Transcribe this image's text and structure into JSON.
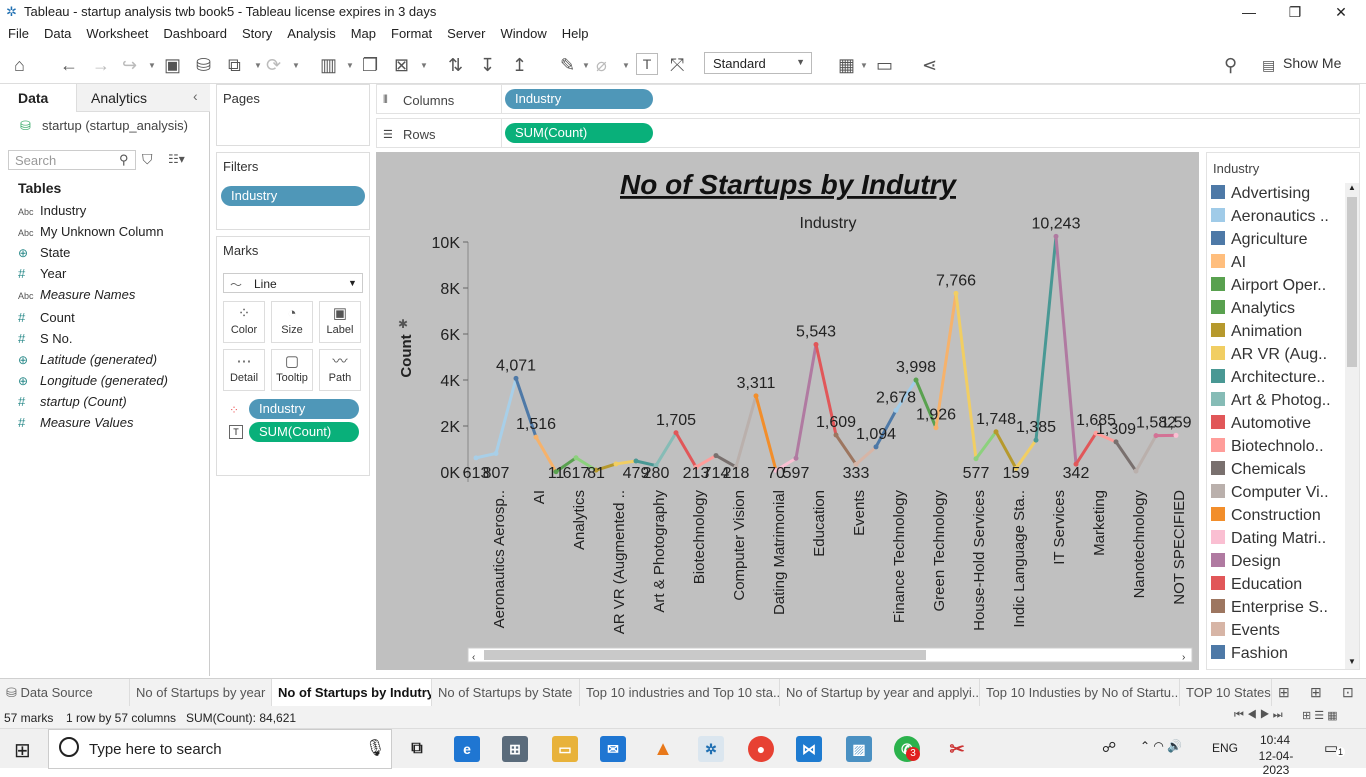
{
  "app": {
    "title": "Tableau - startup analysis twb book5 - Tableau license expires in 3 days",
    "window_controls": {
      "minimize": "—",
      "restore": "❐",
      "close": "✕"
    }
  },
  "menu": [
    "File",
    "Data",
    "Worksheet",
    "Dashboard",
    "Story",
    "Analysis",
    "Map",
    "Format",
    "Server",
    "Window",
    "Help"
  ],
  "toolbar": {
    "fit_select": "Standard",
    "show_me": "Show Me"
  },
  "left_pane": {
    "tabs": {
      "data": "Data",
      "analytics": "Analytics"
    },
    "datasource": "startup (startup_analysis)",
    "search_placeholder": "Search",
    "tables_header": "Tables",
    "fields": [
      {
        "type": "Abc",
        "name": "Industry",
        "italic": false,
        "kind": "dim"
      },
      {
        "type": "Abc",
        "name": "My Unknown Column",
        "italic": false,
        "kind": "dim"
      },
      {
        "type": "geo",
        "name": "State",
        "italic": false,
        "kind": "geo"
      },
      {
        "type": "#",
        "name": "Year",
        "italic": false,
        "kind": "num"
      },
      {
        "type": "Abc",
        "name": "Measure Names",
        "italic": true,
        "kind": "dim"
      },
      {
        "type": "#",
        "name": "Count",
        "italic": false,
        "kind": "num"
      },
      {
        "type": "#",
        "name": "S No.",
        "italic": false,
        "kind": "num"
      },
      {
        "type": "geo",
        "name": "Latitude (generated)",
        "italic": true,
        "kind": "geo"
      },
      {
        "type": "geo",
        "name": "Longitude (generated)",
        "italic": true,
        "kind": "geo"
      },
      {
        "type": "#",
        "name": "startup (Count)",
        "italic": true,
        "kind": "num"
      },
      {
        "type": "#",
        "name": "Measure Values",
        "italic": true,
        "kind": "num"
      }
    ]
  },
  "cards": {
    "pages": "Pages",
    "filters": "Filters",
    "filter_pill": "Industry",
    "marks": "Marks",
    "mark_type": "Line",
    "mark_buttons": [
      "Color",
      "Size",
      "Label",
      "Detail",
      "Tooltip",
      "Path"
    ],
    "mark_pills": [
      "Industry",
      "SUM(Count)"
    ]
  },
  "shelves": {
    "columns_label": "Columns",
    "columns_pill": "Industry",
    "rows_label": "Rows",
    "rows_pill": "SUM(Count)"
  },
  "chart_data": {
    "type": "line",
    "title": "No of Startups by Indutry",
    "header": "Industry",
    "ylabel": "Count",
    "ylim": [
      0,
      11000
    ],
    "yticks": [
      "0K",
      "2K",
      "4K",
      "6K",
      "8K",
      "10K"
    ],
    "x_labels": [
      "Aeronautics Aerosp..",
      "AI",
      "Analytics",
      "AR VR (Augmented ..",
      "Art & Photography",
      "Biotechnology",
      "Computer Vision",
      "Dating Matrimonial",
      "Education",
      "Events",
      "Finance Technology",
      "Green Technology",
      "House-Hold Services",
      "Indic Language Sta..",
      "IT Services",
      "Marketing",
      "Nanotechnology",
      "NOT SPECIFIED"
    ],
    "points": [
      {
        "label": "613",
        "value": 613,
        "color": "#a8cfe8"
      },
      {
        "label": "807",
        "value": 807,
        "color": "#a8cfe8"
      },
      {
        "label": "4,071",
        "value": 4071,
        "color": "#4e79a7"
      },
      {
        "label": "1,516",
        "value": 1516,
        "color": "#f6b26b"
      },
      {
        "label": "11",
        "value": 11,
        "color": "#59a14f"
      },
      {
        "label": "617",
        "value": 617,
        "color": "#8cd17d"
      },
      {
        "label": "81",
        "value": 81,
        "color": "#b6992d"
      },
      {
        "label": "",
        "value": 350,
        "color": "#f1ce63"
      },
      {
        "label": "479",
        "value": 479,
        "color": "#499894"
      },
      {
        "label": "280",
        "value": 280,
        "color": "#86bcb6"
      },
      {
        "label": "1,705",
        "value": 1705,
        "color": "#e15759"
      },
      {
        "label": "213",
        "value": 213,
        "color": "#ff9d9a"
      },
      {
        "label": "714",
        "value": 714,
        "color": "#79706e"
      },
      {
        "label": "218",
        "value": 218,
        "color": "#bab0ac"
      },
      {
        "label": "3,311",
        "value": 3311,
        "color": "#f28e2b"
      },
      {
        "label": "70",
        "value": 70,
        "color": "#fabfd2"
      },
      {
        "label": "597",
        "value": 597,
        "color": "#b07aa1"
      },
      {
        "label": "5,543",
        "value": 5543,
        "color": "#e15759"
      },
      {
        "label": "1,609",
        "value": 1609,
        "color": "#9d7660"
      },
      {
        "label": "333",
        "value": 333,
        "color": "#d7b5a6"
      },
      {
        "label": "1,094",
        "value": 1094,
        "color": "#4e79a7"
      },
      {
        "label": "2,678",
        "value": 2678,
        "color": "#a0cbe8"
      },
      {
        "label": "3,998",
        "value": 3998,
        "color": "#59a14f"
      },
      {
        "label": "1,926",
        "value": 1926,
        "color": "#f6b26b"
      },
      {
        "label": "7,766",
        "value": 7766,
        "color": "#f1ce63"
      },
      {
        "label": "577",
        "value": 577,
        "color": "#8cd17d"
      },
      {
        "label": "1,748",
        "value": 1748,
        "color": "#b6992d"
      },
      {
        "label": "159",
        "value": 159,
        "color": "#f1ce63"
      },
      {
        "label": "1,385",
        "value": 1385,
        "color": "#499894"
      },
      {
        "label": "10,243",
        "value": 10243,
        "color": "#b07aa1"
      },
      {
        "label": "342",
        "value": 342,
        "color": "#e15759"
      },
      {
        "label": "1,685",
        "value": 1685,
        "color": "#ff9d9a"
      },
      {
        "label": "1,309",
        "value": 1309,
        "color": "#79706e"
      },
      {
        "label": "",
        "value": 40,
        "color": "#bab0ac"
      },
      {
        "label": "1,582",
        "value": 1582,
        "color": "#d37295"
      },
      {
        "label": "1,59",
        "value": 1590,
        "color": "#fabfd2"
      }
    ]
  },
  "legend": {
    "title": "Industry",
    "items": [
      {
        "name": "Advertising",
        "color": "#4e79a7"
      },
      {
        "name": "Aeronautics ..",
        "color": "#a0cbe8"
      },
      {
        "name": "Agriculture",
        "color": "#4e79a7"
      },
      {
        "name": "AI",
        "color": "#ffbe7d"
      },
      {
        "name": "Airport Oper..",
        "color": "#59a14f"
      },
      {
        "name": "Analytics",
        "color": "#59a14f"
      },
      {
        "name": "Animation",
        "color": "#b6992d"
      },
      {
        "name": "AR VR (Aug..",
        "color": "#f1ce63"
      },
      {
        "name": "Architecture..",
        "color": "#499894"
      },
      {
        "name": "Art & Photog..",
        "color": "#86bcb6"
      },
      {
        "name": "Automotive",
        "color": "#e15759"
      },
      {
        "name": "Biotechnolo..",
        "color": "#ff9d9a"
      },
      {
        "name": "Chemicals",
        "color": "#79706e"
      },
      {
        "name": "Computer Vi..",
        "color": "#bab0ac"
      },
      {
        "name": "Construction",
        "color": "#f28e2b"
      },
      {
        "name": "Dating Matri..",
        "color": "#fabfd2"
      },
      {
        "name": "Design",
        "color": "#b07aa1"
      },
      {
        "name": "Education",
        "color": "#e15759"
      },
      {
        "name": "Enterprise S..",
        "color": "#9d7660"
      },
      {
        "name": "Events",
        "color": "#d7b5a6"
      },
      {
        "name": "Fashion",
        "color": "#4e79a7"
      }
    ]
  },
  "sheet_tabs": {
    "data_source": "Data Source",
    "tabs": [
      "No of Startups by year",
      "No of Startups by Indutry",
      "No of Startups by State",
      "Top 10 industries and Top 10 sta...",
      "No of Startup by year and applyi...",
      "Top 10 Industies by No of Startu...",
      "TOP 10 States I"
    ],
    "active": 1
  },
  "status": {
    "marks": "57 marks",
    "dims": "1 row by 57 columns",
    "sum": "SUM(Count): 84,621"
  },
  "taskbar": {
    "search_placeholder": "Type here to search",
    "lang": "ENG",
    "time": "10:44",
    "date": "12-04-2023",
    "whatsapp_badge": "3",
    "notif_count": "1"
  }
}
